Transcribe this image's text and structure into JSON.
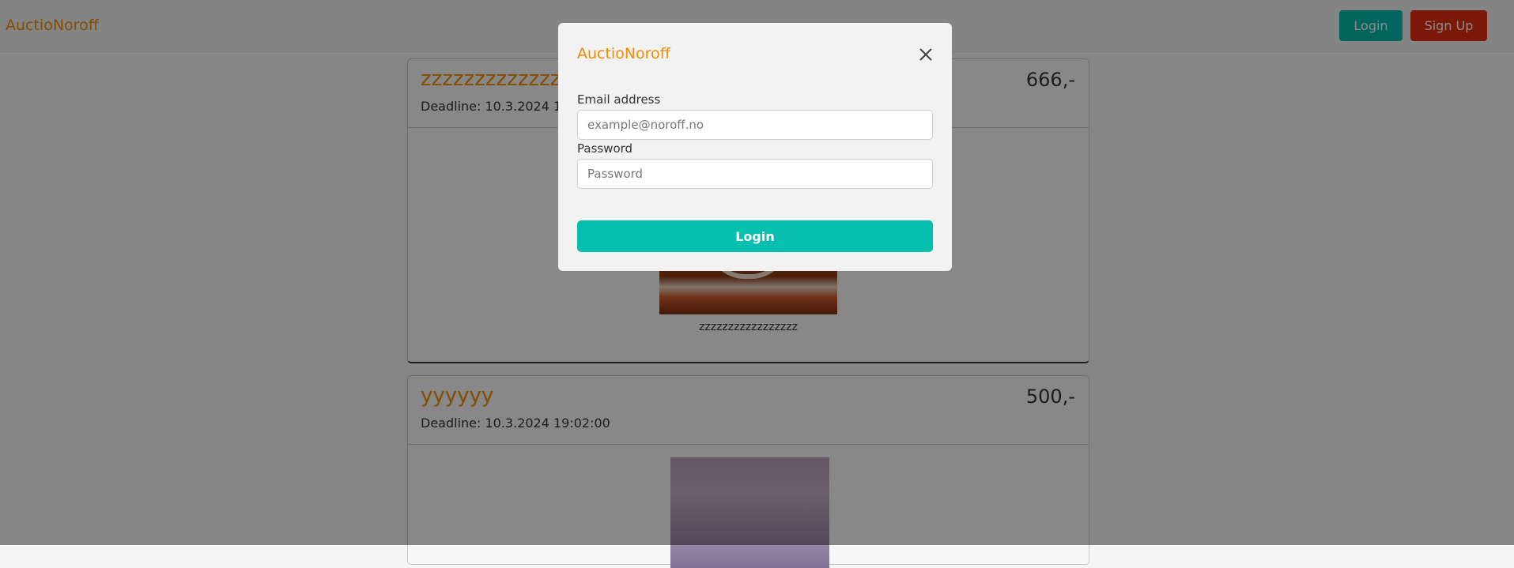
{
  "navbar": {
    "brand": "AuctioNoroff",
    "login_label": "Login",
    "signup_label": "Sign Up"
  },
  "listings": [
    {
      "title": "zzzzzzzzzzzzzzzzz",
      "deadline": "Deadline: 10.3.2024 12:",
      "price": "666,-",
      "caption": "zzzzzzzzzzzzzzzzz"
    },
    {
      "title": "yyyyyy",
      "deadline": "Deadline: 10.3.2024 19:02:00",
      "price": "500,-"
    }
  ],
  "modal": {
    "title": "AuctioNoroff",
    "email_label": "Email address",
    "email_placeholder": "example@noroff.no",
    "password_label": "Password",
    "password_placeholder": "Password",
    "submit_label": "Login",
    "close_icon": "close-icon"
  },
  "colors": {
    "brand": "#f08c00",
    "login_button": "#00b8a9",
    "signup_button": "#e02d12",
    "submit_button": "#06bfae"
  }
}
